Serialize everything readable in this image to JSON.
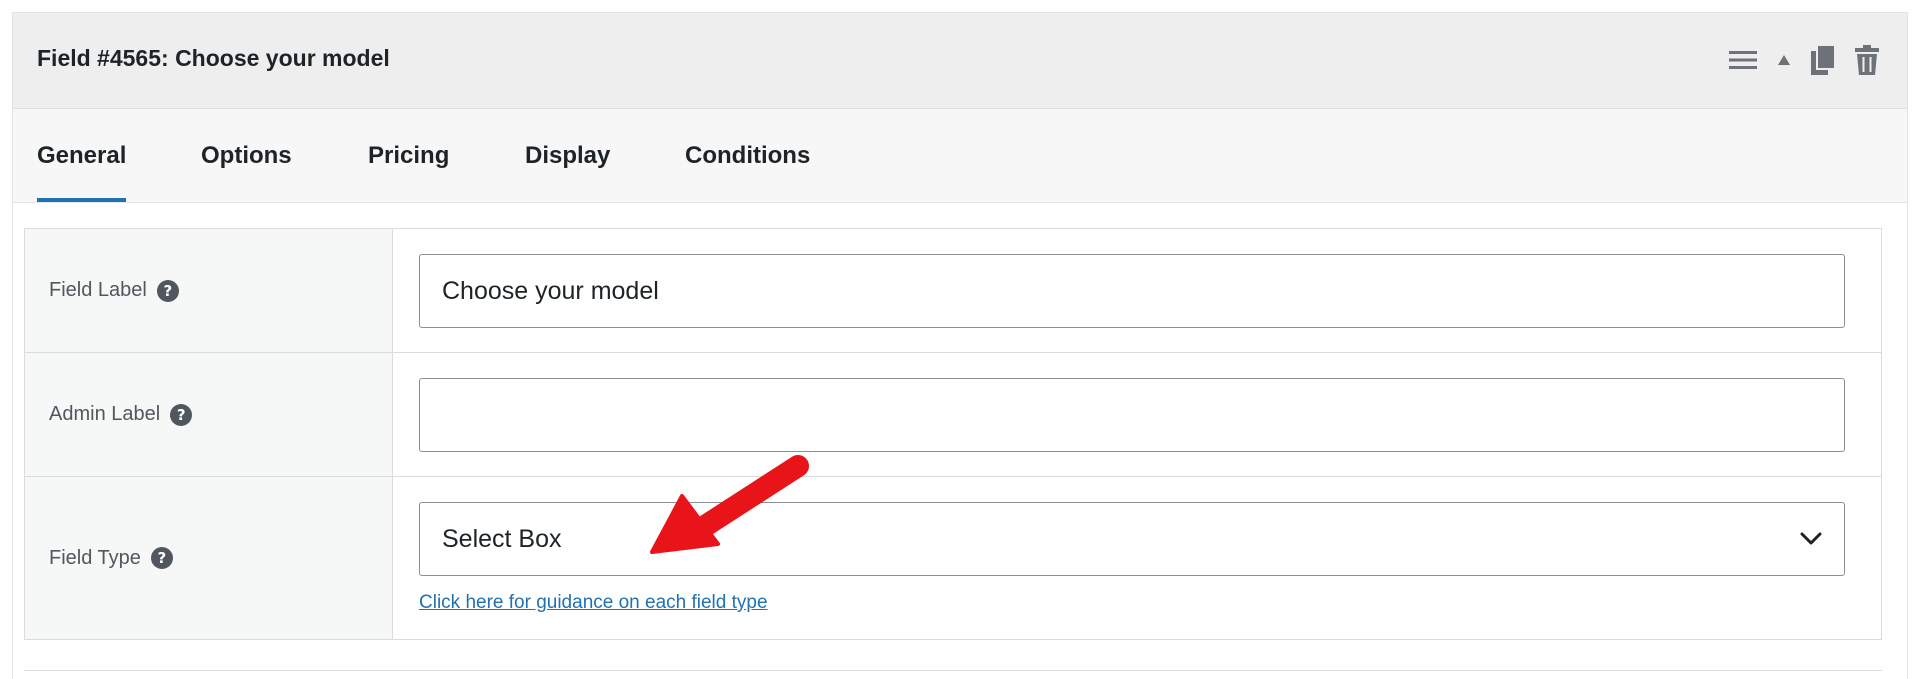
{
  "panel": {
    "title": "Field #4565: Choose your model",
    "actions": [
      {
        "name": "drag-handle",
        "icon": "hamburger-menu-icon"
      },
      {
        "name": "collapse",
        "icon": "caret-up-icon"
      },
      {
        "name": "duplicate",
        "icon": "copy-icon"
      },
      {
        "name": "delete",
        "icon": "trash-icon"
      }
    ]
  },
  "tabs": [
    {
      "label": "General",
      "active": true
    },
    {
      "label": "Options",
      "active": false
    },
    {
      "label": "Pricing",
      "active": false
    },
    {
      "label": "Display",
      "active": false
    },
    {
      "label": "Conditions",
      "active": false
    }
  ],
  "form": {
    "field_label": {
      "label": "Field Label",
      "value": "Choose your model",
      "help_icon": "question-circle-icon"
    },
    "admin_label": {
      "label": "Admin Label",
      "value": "",
      "help_icon": "question-circle-icon"
    },
    "field_type": {
      "label": "Field Type",
      "selected": "Select Box",
      "help_icon": "question-circle-icon",
      "guidance_link": "Click here for guidance on each field type"
    }
  },
  "colors": {
    "accent": "#2271b1",
    "annotation_arrow": "#e8141a",
    "header_bg": "#eeeeee",
    "label_bg": "#f6f7f7"
  }
}
